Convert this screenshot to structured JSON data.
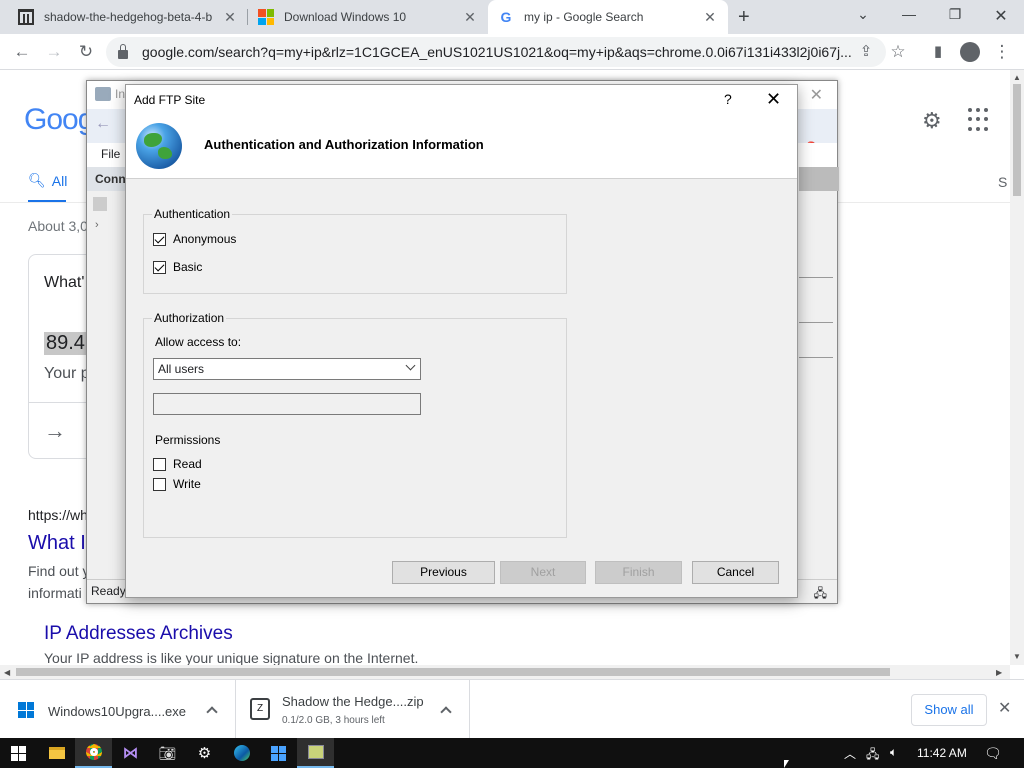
{
  "browser": {
    "tabs": [
      {
        "title": "shadow-the-hedgehog-beta-4-b",
        "icon": "archive-icon"
      },
      {
        "title": "Download Windows 10",
        "icon": "windows-icon"
      },
      {
        "title": "my ip - Google Search",
        "icon": "google-icon"
      }
    ],
    "url": "google.com/search?q=my+ip&rlz=1C1GCEA_enUS1021US1021&oq=my+ip&aqs=chrome.0.0i67i131i433l2j0i67j..."
  },
  "google": {
    "logo": "Goog",
    "tab_all": "All",
    "tab_s": "S",
    "about": "About 3,0",
    "card_question": "What'",
    "ip": "89.4",
    "your": "Your p",
    "result_url": "https://wh",
    "result_title": "What I",
    "snippet1": "Find out y",
    "snippet2": "informati",
    "result2_title": "IP Addresses Archives",
    "result2_snippet": "Your IP address is like your unique signature on the Internet."
  },
  "iis": {
    "title": "In",
    "menu_file": "File",
    "connections": "Conne",
    "status": "Ready"
  },
  "dialog": {
    "title": "Add FTP Site",
    "help": "?",
    "heading": "Authentication and Authorization Information",
    "authentication": {
      "label": "Authentication",
      "anonymous": "Anonymous",
      "basic": "Basic"
    },
    "authorization": {
      "label": "Authorization",
      "allow_label": "Allow access to:",
      "allow_value": "All users",
      "user_text": ""
    },
    "permissions": {
      "label": "Permissions",
      "read": "Read",
      "write": "Write"
    },
    "buttons": {
      "previous": "Previous",
      "next": "Next",
      "finish": "Finish",
      "cancel": "Cancel"
    }
  },
  "downloads": {
    "items": [
      {
        "name": "Windows10Upgra....exe",
        "sub": ""
      },
      {
        "name": "Shadow the Hedge....zip",
        "sub": "0.1/2.0 GB, 3 hours left"
      }
    ],
    "show_all": "Show all"
  },
  "taskbar": {
    "time": "11:42 AM"
  }
}
